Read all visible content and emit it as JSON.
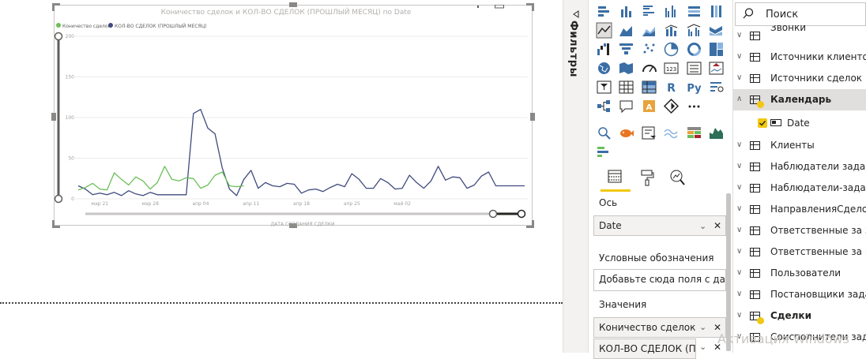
{
  "chart_data": {
    "type": "line",
    "title": "Коничество сделок и КОЛ-ВО СДЕЛОК (ПРОШЛЫЙ МЕСЯЦ) по Date",
    "xlabel": "ДАТА СОЗДАНИЯ СДЕЛКИ",
    "ylabel": "",
    "ylim": [
      0,
      200
    ],
    "yticks": [
      "0",
      "50",
      "100",
      "150",
      "200"
    ],
    "xticks": [
      "мар 21",
      "мар 28",
      "апр 04",
      "апр 11",
      "апр 18",
      "апр 25",
      "май 02"
    ],
    "grid": true,
    "legend_position": "top-left",
    "x_range": [
      0,
      62
    ],
    "series": [
      {
        "name": "Коничество сделок",
        "color": "#6bbf59",
        "x": [
          0,
          1,
          2,
          3,
          4,
          5,
          6,
          7,
          8,
          9,
          10,
          11,
          12,
          13,
          14,
          15,
          16,
          17,
          18,
          19,
          20,
          21,
          22,
          23
        ],
        "values": [
          11,
          14,
          19,
          12,
          11,
          32,
          24,
          17,
          27,
          22,
          12,
          20,
          40,
          24,
          22,
          26,
          25,
          13,
          17,
          29,
          33,
          16,
          15,
          16
        ]
      },
      {
        "name": "КОЛ-ВО СДЕЛОК (ПРОШЛЫЙ МЕСЯЦ)",
        "color": "#3f4a7d",
        "x": [
          0,
          1,
          2,
          3,
          4,
          5,
          6,
          7,
          8,
          9,
          10,
          11,
          12,
          13,
          14,
          15,
          16,
          17,
          18,
          19,
          20,
          21,
          22,
          23,
          24,
          25,
          26,
          27,
          28,
          29,
          30,
          31,
          32,
          33,
          34,
          35,
          36,
          37,
          38,
          39,
          40,
          41,
          42,
          43,
          44,
          45,
          46,
          47,
          48,
          49,
          50,
          51,
          52,
          53,
          54,
          55,
          56,
          57,
          58,
          59,
          60,
          61,
          62
        ],
        "values": [
          16,
          12,
          5,
          7,
          5,
          8,
          4,
          10,
          6,
          4,
          8,
          5,
          5,
          5,
          5,
          5,
          105,
          110,
          87,
          80,
          38,
          12,
          4,
          24,
          35,
          13,
          20,
          16,
          15,
          19,
          18,
          7,
          11,
          12,
          9,
          14,
          18,
          15,
          31,
          24,
          13,
          13,
          25,
          20,
          12,
          13,
          29,
          20,
          13,
          22,
          40,
          23,
          27,
          26,
          13,
          17,
          28,
          33,
          16,
          16,
          16,
          16,
          16
        ]
      }
    ]
  },
  "visual": {
    "overflow_icon": "more-options-icon",
    "focus_icon": "focus-mode-icon"
  },
  "filters": {
    "label": "Фильтры",
    "collapse_icon": "triangle-left-icon"
  },
  "viz_tabs": {
    "format_icon": "paint-roller-icon",
    "analytics_icon": "magnifier-chart-icon",
    "fields_icon": "fields-grid-icon"
  },
  "wells": {
    "axis_title": "Ось",
    "axis_field": "Date",
    "legend_title": "Условные обозначения",
    "legend_placeholder": "Добавьте сюда поля с дан...",
    "values_title": "Значения",
    "values_field_1": "Коничество сделок",
    "values_field_2": "КОЛ-ВО СДЕЛОК (ПРО"
  },
  "fields": {
    "search_placeholder": "Поиск",
    "items": [
      {
        "label": "Звонки",
        "type": "table",
        "expanded": false
      },
      {
        "label": "Источники клиентов",
        "type": "table",
        "expanded": false
      },
      {
        "label": "Источники сделок",
        "type": "table",
        "expanded": false
      },
      {
        "label": "Календарь",
        "type": "table",
        "expanded": true,
        "selected": true
      },
      {
        "label": "Date",
        "type": "field",
        "checked": true
      },
      {
        "label": "Клиенты",
        "type": "table",
        "expanded": false
      },
      {
        "label": "Наблюдатели задач",
        "type": "table",
        "expanded": false
      },
      {
        "label": "Наблюдатели-задачи",
        "type": "table",
        "expanded": false
      },
      {
        "label": "НаправленияСделок",
        "type": "table",
        "expanded": false
      },
      {
        "label": "Ответственные за зада",
        "type": "table",
        "expanded": false
      },
      {
        "label": "Ответственные за кли",
        "type": "table",
        "expanded": false
      },
      {
        "label": "Пользователи",
        "type": "table",
        "expanded": false
      },
      {
        "label": "Постановщики задач",
        "type": "table",
        "expanded": false
      },
      {
        "label": "Сделки",
        "type": "table",
        "expanded": false,
        "selected": true
      },
      {
        "label": "Соисполнители задач",
        "type": "table",
        "expanded": false
      }
    ]
  },
  "watermark": "Активация Windows",
  "colors": {
    "accent": "#f2c811",
    "series1": "#6bbf59",
    "series2": "#3f4a7d",
    "selected_row": "#e1dfdd"
  }
}
